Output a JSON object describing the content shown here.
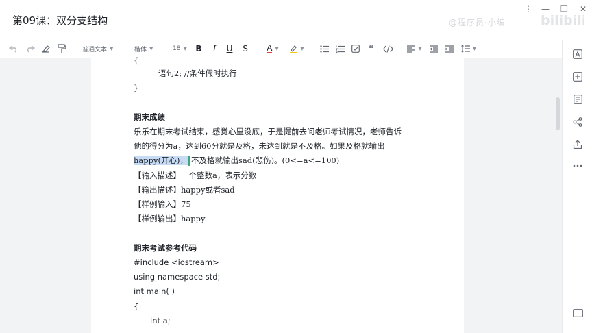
{
  "window": {
    "title": "第09课：双分支结构",
    "more_icon": "⋮",
    "minimize_icon": "—",
    "restore_icon": "❐",
    "close_icon": "✕"
  },
  "overlay": {
    "watermark": "@程序员·小编",
    "logo": "bilibili"
  },
  "toolbar": {
    "style_value": "普通文本",
    "font_value": "楷体",
    "size_value": "18",
    "bold": "B",
    "italic": "I",
    "underline": "U",
    "strike": "S",
    "font_color": "A",
    "quote": "❝"
  },
  "document": {
    "line1": "{",
    "line2": "语句2;      //条件假时执行",
    "line3": "}",
    "heading1": "期末成绩",
    "para1": "乐乐在期末考试结束，感觉心里没底，于是提前去问老师考试情况，老师告诉",
    "para2": "他的得分为a，达到60分就是及格，未达到就是不及格。如果及格就输出",
    "para3_selected": "happy(开心)，",
    "para3_rest": "不及格就输出sad(悲伤)。(0<=a<=100)",
    "input_desc": "【输入描述】一个整数a，表示分数",
    "output_desc": "【输出描述】happy或者sad",
    "sample_input": "【样例输入】75",
    "sample_output": "【样例输出】happy",
    "heading2": "期末考试参考代码",
    "code1": "#include <iostream>",
    "code2": "using namespace std;",
    "code3": "int main( )",
    "code4": "{",
    "code5": "int a;"
  },
  "sidepanel": {
    "icons": [
      "format-icon",
      "add-icon",
      "outline-icon",
      "share-icon",
      "export-icon",
      "more-icon",
      "minimize-panel-icon"
    ]
  },
  "colors": {
    "selection": "#c8dbf5",
    "cursor": "#3fa67a",
    "highlight": "#f5c518",
    "text": "#1f2329",
    "canvas": "#f2f3f5"
  }
}
